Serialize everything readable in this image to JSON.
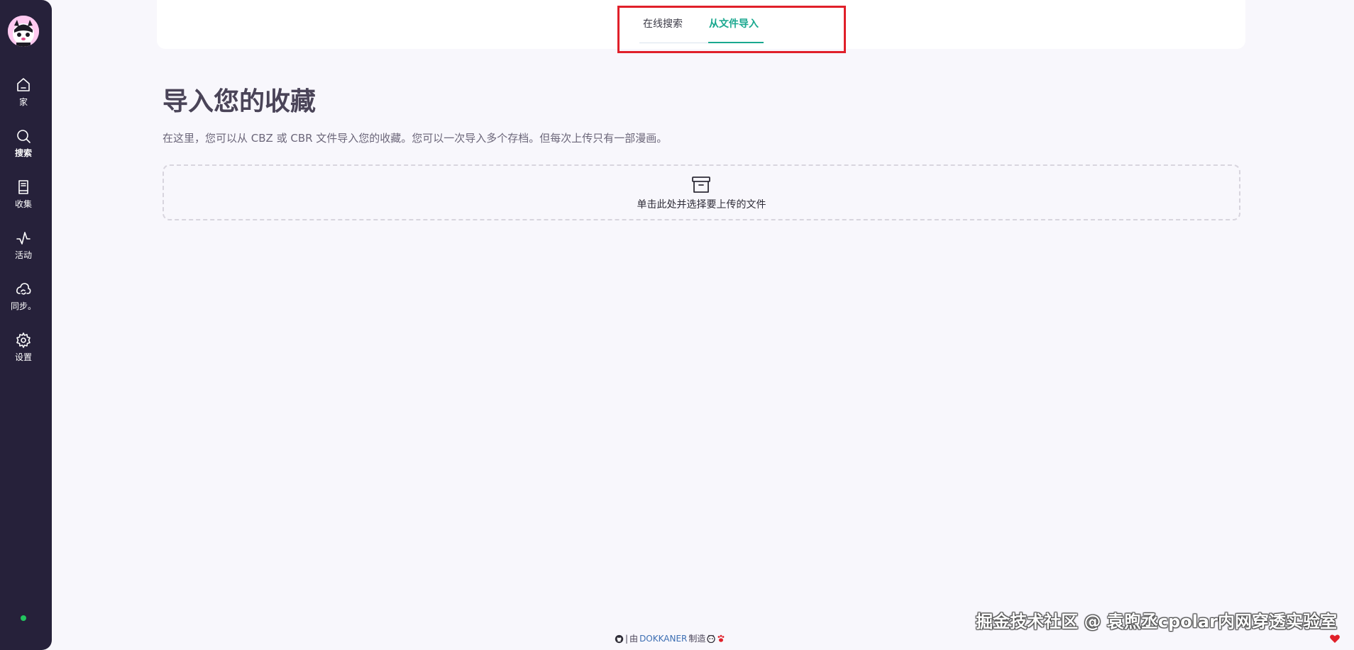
{
  "sidebar": {
    "items": [
      {
        "label": "家",
        "icon": "home-icon"
      },
      {
        "label": "搜索",
        "icon": "search-icon"
      },
      {
        "label": "收集",
        "icon": "book-icon"
      },
      {
        "label": "活动",
        "icon": "activity-icon"
      },
      {
        "label": "同步。",
        "icon": "cloud-sync-icon"
      },
      {
        "label": "设置",
        "icon": "gear-icon"
      }
    ],
    "status_color": "#22c55e"
  },
  "tabs": [
    {
      "label": "在线搜索",
      "active": false
    },
    {
      "label": "从文件导入",
      "active": true
    }
  ],
  "main": {
    "title": "导入您的收藏",
    "description": "在这里，您可以从 CBZ 或 CBR 文件导入您的收藏。您可以一次导入多个存档。但每次上传只有一部漫画。",
    "drop_zone": {
      "icon": "archive-icon",
      "label": "单击此处并选择要上传的文件"
    }
  },
  "footer": {
    "separator": "|",
    "by": "由",
    "brand": "DOKKANER",
    "made": "制造"
  },
  "watermark": "掘金技术社区 @ 袁煦丞cpolar内网穿透实验室",
  "colors": {
    "sidebar_bg": "#26213a",
    "accent": "#1aa88f",
    "highlight": "#e0202a",
    "page_bg": "#f8f7fc"
  }
}
